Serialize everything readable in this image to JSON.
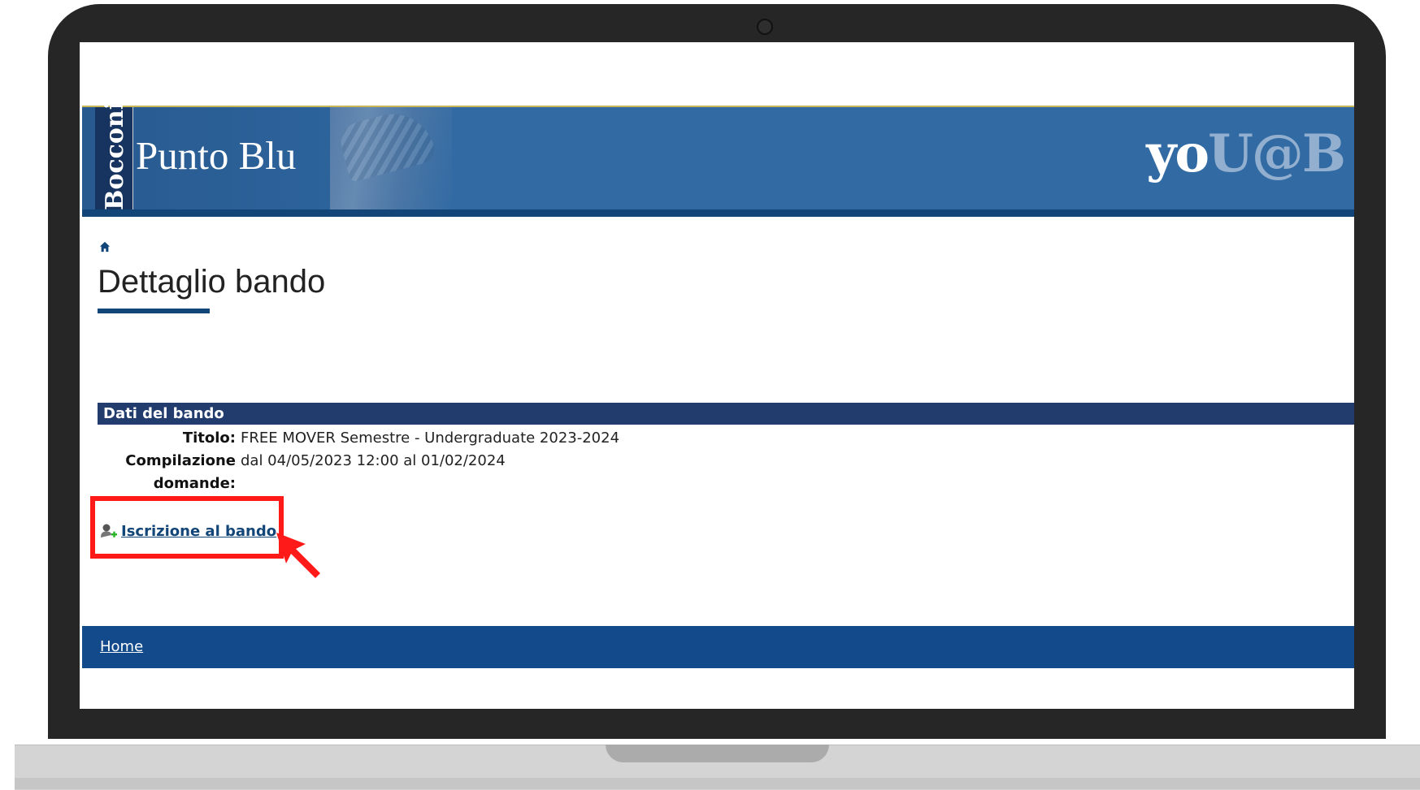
{
  "header": {
    "brand_vertical": "Bocconi",
    "brand_name": "Punto Blu",
    "logo_right_a": "yo",
    "logo_right_b": "U@B"
  },
  "breadcrumb": {
    "home_icon": "home-icon"
  },
  "page": {
    "title": "Dettaglio bando"
  },
  "section": {
    "header": "Dati del bando",
    "fields": [
      {
        "label": "Titolo:",
        "value": "FREE MOVER Semestre - Undergraduate 2023-2024"
      },
      {
        "label": "Compilazione",
        "label_line2": "domande:",
        "value": "dal 04/05/2023 12:00 al 01/02/2024"
      }
    ]
  },
  "actions": {
    "enroll_label": "Iscrizione al bando",
    "enroll_icon": "user-add-icon"
  },
  "footer": {
    "home_label": "Home"
  },
  "annotation": {
    "highlight_color": "#ff1a1a",
    "pointer": "red-arrow"
  },
  "colors": {
    "brand_blue": "#326ba3",
    "dark_blue": "#124578",
    "section_blue": "#223c6e"
  }
}
